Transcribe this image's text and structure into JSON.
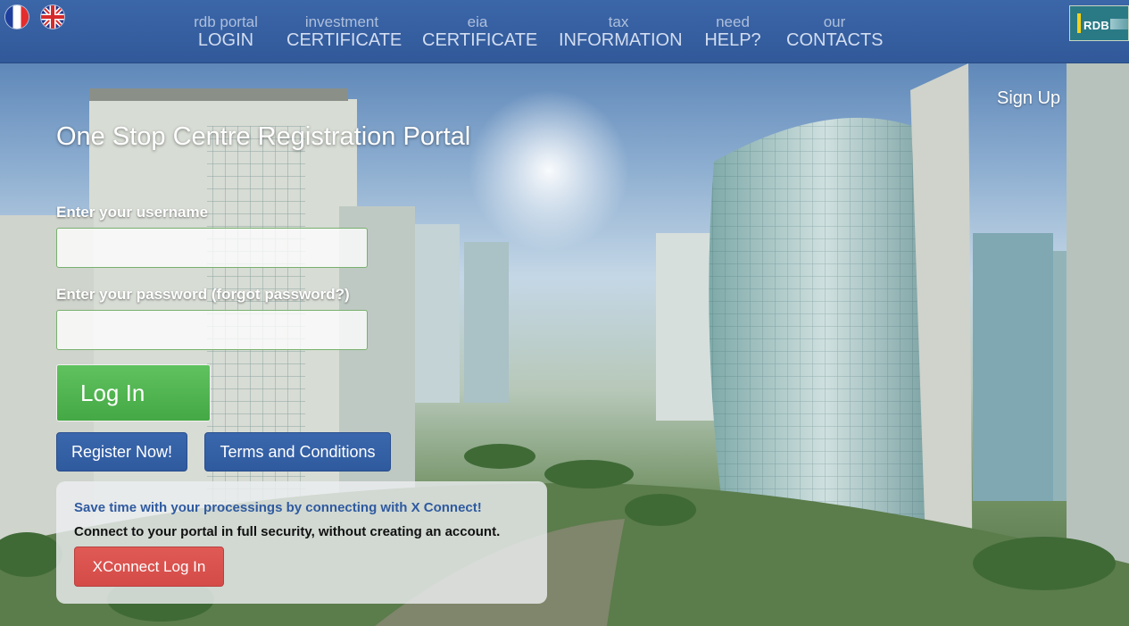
{
  "languages": [
    {
      "code": "fr",
      "icon": "france-flag-icon"
    },
    {
      "code": "en",
      "icon": "uk-flag-icon"
    }
  ],
  "nav": [
    {
      "small": "rdb portal",
      "big": "LOGIN"
    },
    {
      "small": "investment",
      "big": "CERTIFICATE"
    },
    {
      "small": "eia",
      "big": "CERTIFICATE"
    },
    {
      "small": "tax",
      "big": "INFORMATION"
    },
    {
      "small": "need",
      "big": "HELP?"
    },
    {
      "small": "our",
      "big": "CONTACTS"
    }
  ],
  "logo": {
    "text": "RDB"
  },
  "signup_label": "Sign Up",
  "portal_title": "One Stop Centre Registration Portal",
  "form": {
    "username_label": "Enter your username",
    "username_value": "",
    "password_label": "Enter your password",
    "forgot_label": "(forgot password?)",
    "password_value": "",
    "login_label": "Log In",
    "register_label": "Register Now!",
    "terms_label": "Terms and Conditions"
  },
  "xconnect": {
    "heading": "Save time with your processings by connecting with X Connect!",
    "text": "Connect to your portal in full security, without creating an account.",
    "button_label": "XConnect Log In"
  },
  "colors": {
    "nav_bg": "#3461a3",
    "login_green": "#4cb04b",
    "blue_button": "#3461a6",
    "xconnect_red": "#d9534f"
  }
}
